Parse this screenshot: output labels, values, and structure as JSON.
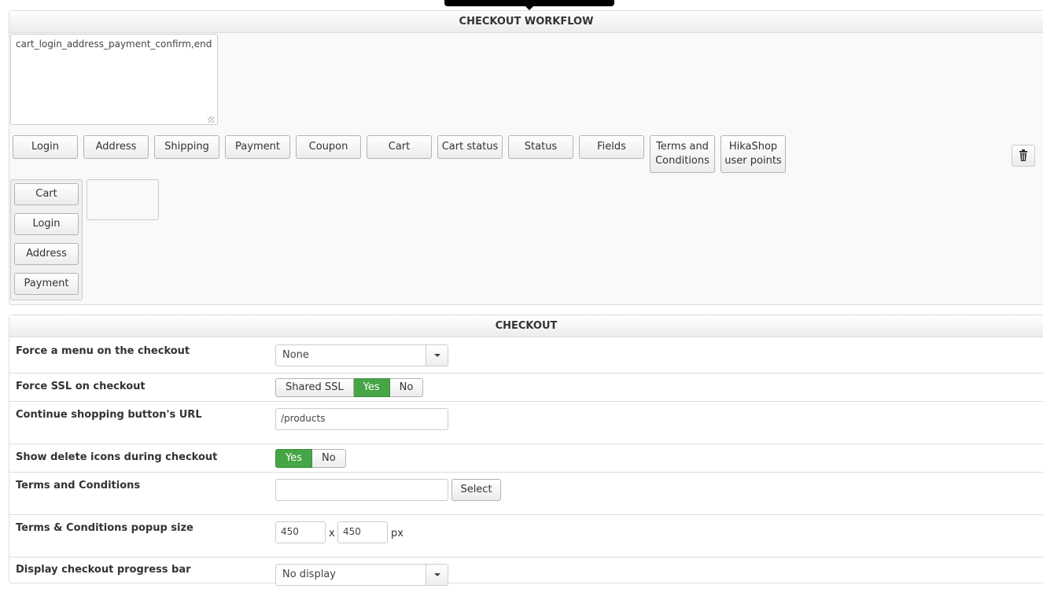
{
  "workflow": {
    "title": "CHECKOUT WORKFLOW",
    "textarea_value": "cart_login_address_payment_confirm,end",
    "available_steps": [
      "Login",
      "Address",
      "Shipping",
      "Payment",
      "Coupon",
      "Cart",
      "Cart status",
      "Status",
      "Fields",
      "Terms and Conditions",
      "HikaShop user points"
    ],
    "step_group": [
      "Cart",
      "Login",
      "Address",
      "Payment"
    ],
    "trash_icon": "trash-icon"
  },
  "checkout": {
    "title": "CHECKOUT",
    "force_menu": {
      "label": "Force a menu on the checkout",
      "value": "None"
    },
    "force_ssl": {
      "label": "Force SSL on checkout",
      "options": [
        "Shared SSL",
        "Yes",
        "No"
      ],
      "selected": "Yes"
    },
    "continue_url": {
      "label": "Continue shopping button's URL",
      "value": "/products"
    },
    "delete_icons": {
      "label": "Show delete icons during checkout",
      "options": [
        "Yes",
        "No"
      ],
      "selected": "Yes"
    },
    "terms": {
      "label": "Terms and Conditions",
      "value": "",
      "button": "Select"
    },
    "popup_size": {
      "label": "Terms & Conditions popup size",
      "width": "450",
      "height": "450",
      "separator": "x",
      "unit": "px"
    },
    "progress_bar": {
      "label": "Display checkout progress bar",
      "value": "No display"
    }
  },
  "colors": {
    "active_toggle": "#46a546",
    "panel_bg": "#f9f9f9"
  }
}
